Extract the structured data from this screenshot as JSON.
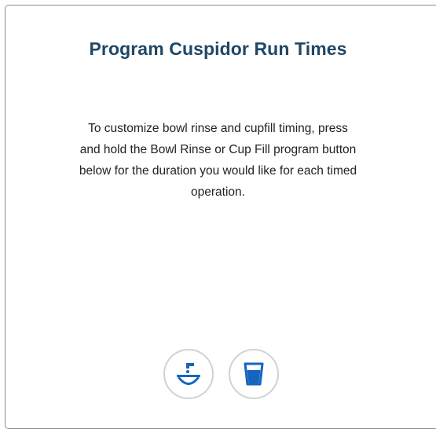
{
  "dialog": {
    "title": "Program Cuspidor Run Times",
    "description_lines": [
      "To customize bowl rinse and cupfill timing, press",
      "and hold the Bowl Rinse or Cup Fill program button",
      "below for the duration you would like for each timed",
      "operation."
    ]
  },
  "buttons": [
    {
      "name": "bowl-rinse-button",
      "icon": "bowl-rinse-icon"
    },
    {
      "name": "cup-fill-button",
      "icon": "cup-fill-icon"
    }
  ],
  "colors": {
    "title": "#1f4766",
    "icon_blue": "#1565c0",
    "button_border": "#cfd3d6",
    "panel_border": "#8a8f94"
  }
}
